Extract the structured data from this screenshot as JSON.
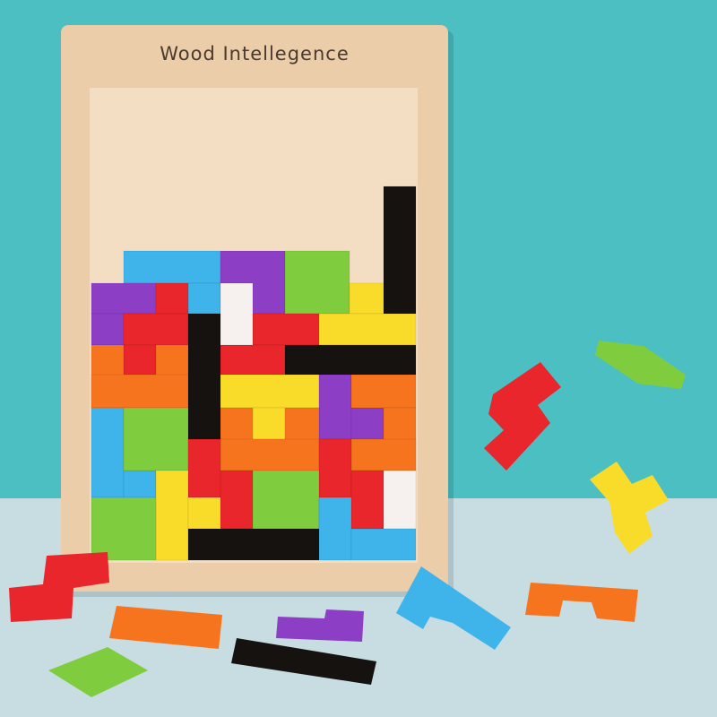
{
  "board": {
    "title": "Wood Intellegence"
  },
  "colors": {
    "wall": "#4cbfc3",
    "floor": "#c8dde2",
    "board": "#ebcda9",
    "recess": "#f3dec4",
    "red": "#e8262b",
    "orange": "#f7741e",
    "yellow": "#f9dc2a",
    "green": "#7fcc3f",
    "light_blue": "#3fb4ea",
    "purple": "#8c3fc4",
    "black": "#151210",
    "white": "#f6f0ee"
  }
}
